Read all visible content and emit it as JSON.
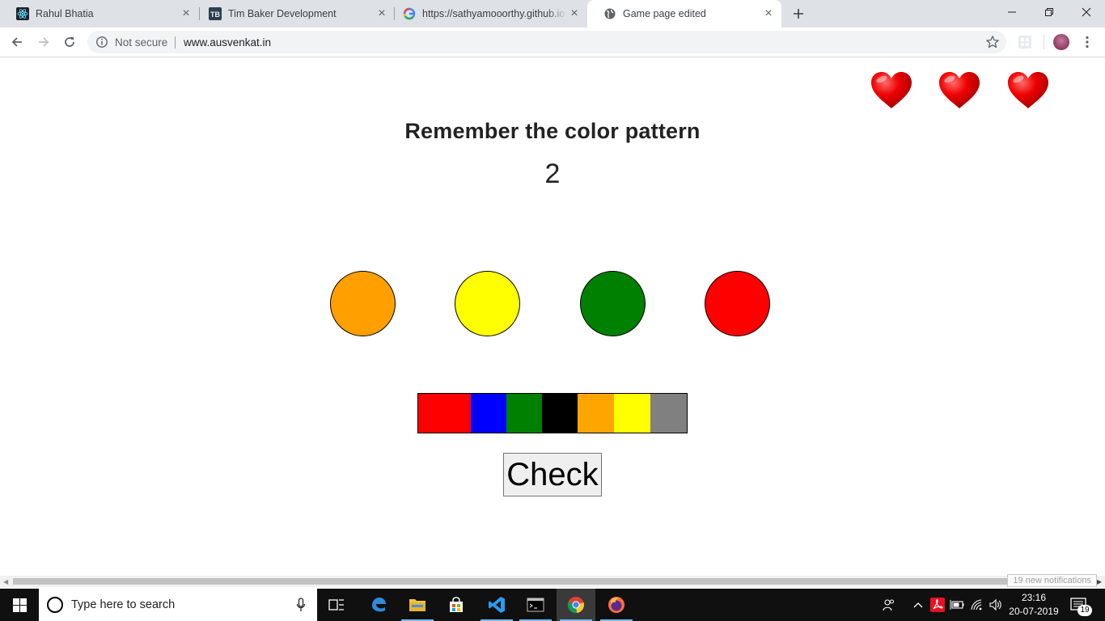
{
  "browser": {
    "tabs": [
      {
        "title": "Rahul Bhatia",
        "favicon": "react-icon"
      },
      {
        "title": "Tim Baker Development",
        "favicon": "tb-logo-icon"
      },
      {
        "title": "https://sathyamooorthy.github.io",
        "favicon": "google-icon"
      },
      {
        "title": "Game page edited",
        "favicon": "globe-icon",
        "active": true
      }
    ],
    "security_label": "Not secure",
    "url": "www.ausvenkat.in"
  },
  "game": {
    "lives": 3,
    "heading": "Remember the color pattern",
    "counter": "2",
    "pattern_colors": [
      "#ffa000",
      "#ffff00",
      "#008000",
      "#ff0000"
    ],
    "palette": [
      {
        "name": "red",
        "color": "#ff0000"
      },
      {
        "name": "blue",
        "color": "#0000ff"
      },
      {
        "name": "green",
        "color": "#008000"
      },
      {
        "name": "black",
        "color": "#000000"
      },
      {
        "name": "orange",
        "color": "#ffa500"
      },
      {
        "name": "yellow",
        "color": "#ffff00"
      },
      {
        "name": "gray",
        "color": "#808080"
      }
    ],
    "check_label": "Check"
  },
  "notification_toast": "19 new notifications",
  "taskbar": {
    "search_placeholder": "Type here to search",
    "time": "23:16",
    "date": "20-07-2019",
    "notification_count": "19"
  }
}
